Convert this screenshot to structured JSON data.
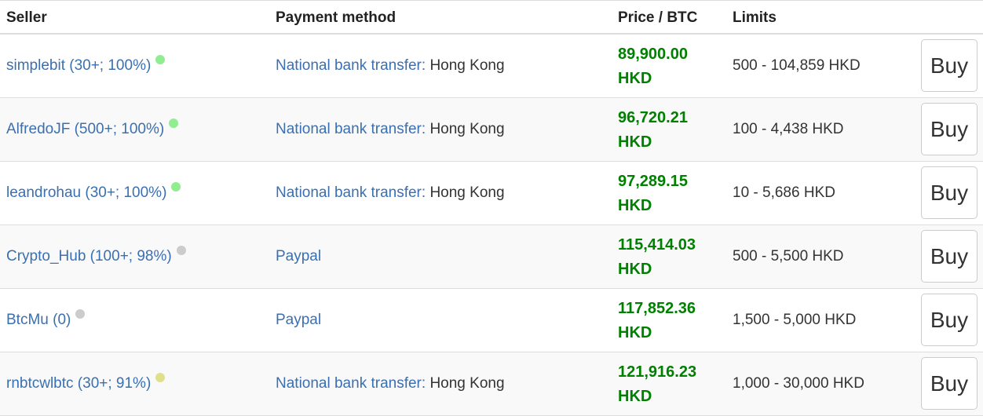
{
  "header": {
    "seller": "Seller",
    "payment": "Payment method",
    "price": "Price / BTC",
    "limits": "Limits"
  },
  "rows": [
    {
      "seller": "simplebit (30+; 100%)",
      "status_color": "#90ee90",
      "payment_link": "National bank transfer:",
      "payment_rest": " Hong Kong",
      "price": "89,900.00",
      "currency": "HKD",
      "limits": "500 - 104,859 HKD",
      "buy": "Buy"
    },
    {
      "seller": "AlfredoJF (500+; 100%)",
      "status_color": "#90ee90",
      "payment_link": "National bank transfer:",
      "payment_rest": " Hong Kong",
      "price": "96,720.21",
      "currency": "HKD",
      "limits": "100 - 4,438 HKD",
      "buy": "Buy"
    },
    {
      "seller": "leandrohau (30+; 100%)",
      "status_color": "#90ee90",
      "payment_link": "National bank transfer:",
      "payment_rest": " Hong Kong",
      "price": "97,289.15",
      "currency": "HKD",
      "limits": "10 - 5,686 HKD",
      "buy": "Buy"
    },
    {
      "seller": "Crypto_Hub (100+; 98%)",
      "status_color": "#cccccc",
      "payment_link": "Paypal",
      "payment_rest": "",
      "price": "115,414.03",
      "currency": "HKD",
      "limits": "500 - 5,500 HKD",
      "buy": "Buy"
    },
    {
      "seller": "BtcMu (0)",
      "status_color": "#cccccc",
      "payment_link": "Paypal",
      "payment_rest": "",
      "price": "117,852.36",
      "currency": "HKD",
      "limits": "1,500 - 5,000 HKD",
      "buy": "Buy"
    },
    {
      "seller": "rnbtcwlbtc (30+; 91%)",
      "status_color": "#e0e08a",
      "payment_link": "National bank transfer:",
      "payment_rest": " Hong Kong",
      "price": "121,916.23",
      "currency": "HKD",
      "limits": "1,000 - 30,000 HKD",
      "buy": "Buy"
    }
  ]
}
